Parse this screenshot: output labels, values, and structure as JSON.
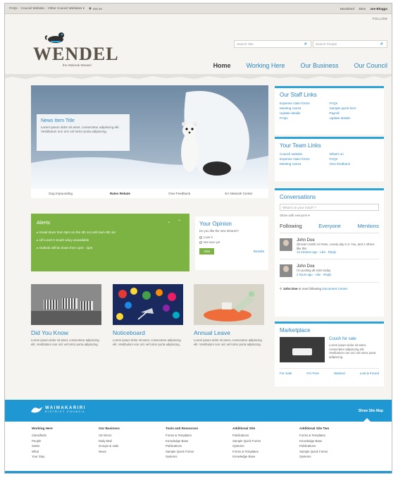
{
  "topbar": {
    "crumbs": [
      "FAQs",
      "Council Website",
      "Other Council Websites ▾"
    ],
    "lang": "ѕѕѕ ѕѕ",
    "right": [
      "Newsfeed",
      "Sites"
    ],
    "user": "Joe Bloggs"
  },
  "follow": "FOLLOW",
  "logo": {
    "name": "WENDEL",
    "tagline": "the Waimak Weasel"
  },
  "search": {
    "site_placeholder": "Search Site",
    "people_placeholder": "Search People"
  },
  "nav": [
    "Home",
    "Working Here",
    "Our Business",
    "Our Council"
  ],
  "hero": {
    "news_title": "News Item Title",
    "news_body": "Lorem ipsum dolor sit amet, consectetur adipiscing elit. Vestibulum non orci vel tortor porta adipiscing.",
    "links": [
      "Dog Impounding",
      "Rates Rebate",
      "Give Feedback",
      "EA Network Center"
    ]
  },
  "staff_links": {
    "title": "Our Staff Links",
    "items": [
      "Expense claim forms",
      "FAQs",
      "Meeting rooms",
      "Sample quick form",
      "Update details",
      "Payroll",
      "FAQs",
      "Update details"
    ]
  },
  "team_links": {
    "title": "Your Team Links",
    "items": [
      "Council website",
      "What's on",
      "Expense claim forms",
      "FAQs",
      "Meeting rooms",
      "Give feedback"
    ]
  },
  "conversations": {
    "title": "Conversations",
    "placeholder": "What's on your mind? ?",
    "share": "Share with everyone ▾",
    "tabs": [
      "Following",
      "Everyone",
      "Mentions"
    ],
    "posts": [
      {
        "name": "John Doe",
        "text": "@Helen Smith Hi Peter, Lovely day is it. You, and 2 others like this",
        "meta": "12 minutes ago · Like · Reply"
      },
      {
        "name": "John Doe",
        "text": "I'm posting all sorts today",
        "meta": "2 hours ago · Like · Reply"
      }
    ],
    "follow_note_user": "John Doe",
    "follow_note_text": " is now following ",
    "follow_note_link": "Document Center"
  },
  "marketplace": {
    "title": "Marketplace",
    "item_title": "Couch for sale",
    "item_body": "Lorem ipsum dolor sit amet, consectetur adipiscing elit. Vestibulum non orci vel tortor porta adipiscing.",
    "tabs": [
      "For Sale",
      "For Free",
      "Wanted",
      "Lost & Found"
    ]
  },
  "alerts": {
    "title": "Alerts",
    "controls": "⌄ ⌃",
    "items": [
      "Email down from 9pm on the 4th Jul until 4am 6th Jul",
      "Lift Level 3 South wing unavailable",
      "Outlook will be down from 1pm - 4pm"
    ]
  },
  "opinion": {
    "title": "Your Opinion",
    "question": "Do you like the new Intranet?",
    "options": [
      "Love it",
      "Not sure yet"
    ],
    "vote": "Vote",
    "results": "Results"
  },
  "cards": [
    {
      "title": "Did You Know",
      "body": "Lorem ipsum dolor sit amet, consectetur adipiscing elit. Vestibulum non orci vel tortor porta adipiscing."
    },
    {
      "title": "Noticeboard",
      "body": "Lorem ipsum dolor sit amet, consectetur adipiscing elit. Vestibulum non orci vel tortor porta adipiscing."
    },
    {
      "title": "Annual Leave",
      "body": "Lorem ipsum dolor sit amet, consectetur adipiscing elit. Vestibulum non orci vel tortor porta adipiscing."
    }
  ],
  "footer": {
    "brand": "WAIMAKARIRI",
    "brand_sub": "DISTRICT COUNCIL",
    "sitemap": "Show Site Map",
    "columns": [
      {
        "title": "Working Here",
        "items": [
          "Classifieds",
          "People",
          "Swiss",
          "What",
          "Your Stay"
        ]
      },
      {
        "title": "Our Business",
        "items": [
          "CE Direct",
          "Daily Mail",
          "Groups & Jads",
          "News"
        ]
      },
      {
        "title": "Tools and Resources",
        "items": [
          "Forms & Templates",
          "Knowledge Base",
          "Publications",
          "Sample Quick Forms",
          "Systems"
        ]
      },
      {
        "title": "Additional Site",
        "items": [
          "Publications",
          "Sample Quick Forms",
          "Systems",
          "Forms & Templates",
          "Knowledge Base"
        ]
      },
      {
        "title": "Additional Site Two",
        "items": [
          "Forms & Templates",
          "Knowledge Base",
          "Publications",
          "Sample Quick Forms",
          "Systems"
        ]
      }
    ]
  },
  "colors": {
    "accent": "#2d87c0",
    "footer": "#1e97d3",
    "alerts": "#7cb342"
  }
}
